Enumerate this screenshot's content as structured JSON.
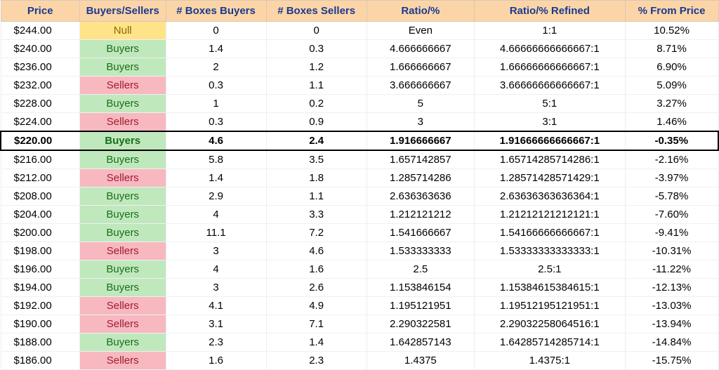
{
  "headers": [
    "Price",
    "Buyers/Sellers",
    "# Boxes Buyers",
    "# Boxes Sellers",
    "Ratio/%",
    "Ratio/% Refined",
    "% From Price"
  ],
  "rows": [
    {
      "price": "$244.00",
      "bs": "Null",
      "bs_class": "bs-null",
      "box_b": "0",
      "box_s": "0",
      "ratio": "Even",
      "refined": "1:1",
      "pct": "10.52%",
      "hl": false
    },
    {
      "price": "$240.00",
      "bs": "Buyers",
      "bs_class": "bs-buyers",
      "box_b": "1.4",
      "box_s": "0.3",
      "ratio": "4.666666667",
      "refined": "4.66666666666667:1",
      "pct": "8.71%",
      "hl": false
    },
    {
      "price": "$236.00",
      "bs": "Buyers",
      "bs_class": "bs-buyers",
      "box_b": "2",
      "box_s": "1.2",
      "ratio": "1.666666667",
      "refined": "1.66666666666667:1",
      "pct": "6.90%",
      "hl": false
    },
    {
      "price": "$232.00",
      "bs": "Sellers",
      "bs_class": "bs-sellers",
      "box_b": "0.3",
      "box_s": "1.1",
      "ratio": "3.666666667",
      "refined": "3.66666666666667:1",
      "pct": "5.09%",
      "hl": false
    },
    {
      "price": "$228.00",
      "bs": "Buyers",
      "bs_class": "bs-buyers",
      "box_b": "1",
      "box_s": "0.2",
      "ratio": "5",
      "refined": "5:1",
      "pct": "3.27%",
      "hl": false
    },
    {
      "price": "$224.00",
      "bs": "Sellers",
      "bs_class": "bs-sellers",
      "box_b": "0.3",
      "box_s": "0.9",
      "ratio": "3",
      "refined": "3:1",
      "pct": "1.46%",
      "hl": false
    },
    {
      "price": "$220.00",
      "bs": "Buyers",
      "bs_class": "bs-buyers",
      "box_b": "4.6",
      "box_s": "2.4",
      "ratio": "1.916666667",
      "refined": "1.91666666666667:1",
      "pct": "-0.35%",
      "hl": true
    },
    {
      "price": "$216.00",
      "bs": "Buyers",
      "bs_class": "bs-buyers",
      "box_b": "5.8",
      "box_s": "3.5",
      "ratio": "1.657142857",
      "refined": "1.65714285714286:1",
      "pct": "-2.16%",
      "hl": false
    },
    {
      "price": "$212.00",
      "bs": "Sellers",
      "bs_class": "bs-sellers",
      "box_b": "1.4",
      "box_s": "1.8",
      "ratio": "1.285714286",
      "refined": "1.28571428571429:1",
      "pct": "-3.97%",
      "hl": false
    },
    {
      "price": "$208.00",
      "bs": "Buyers",
      "bs_class": "bs-buyers",
      "box_b": "2.9",
      "box_s": "1.1",
      "ratio": "2.636363636",
      "refined": "2.63636363636364:1",
      "pct": "-5.78%",
      "hl": false
    },
    {
      "price": "$204.00",
      "bs": "Buyers",
      "bs_class": "bs-buyers",
      "box_b": "4",
      "box_s": "3.3",
      "ratio": "1.212121212",
      "refined": "1.21212121212121:1",
      "pct": "-7.60%",
      "hl": false
    },
    {
      "price": "$200.00",
      "bs": "Buyers",
      "bs_class": "bs-buyers",
      "box_b": "11.1",
      "box_s": "7.2",
      "ratio": "1.541666667",
      "refined": "1.54166666666667:1",
      "pct": "-9.41%",
      "hl": false
    },
    {
      "price": "$198.00",
      "bs": "Sellers",
      "bs_class": "bs-sellers",
      "box_b": "3",
      "box_s": "4.6",
      "ratio": "1.533333333",
      "refined": "1.53333333333333:1",
      "pct": "-10.31%",
      "hl": false
    },
    {
      "price": "$196.00",
      "bs": "Buyers",
      "bs_class": "bs-buyers",
      "box_b": "4",
      "box_s": "1.6",
      "ratio": "2.5",
      "refined": "2.5:1",
      "pct": "-11.22%",
      "hl": false
    },
    {
      "price": "$194.00",
      "bs": "Buyers",
      "bs_class": "bs-buyers",
      "box_b": "3",
      "box_s": "2.6",
      "ratio": "1.153846154",
      "refined": "1.15384615384615:1",
      "pct": "-12.13%",
      "hl": false
    },
    {
      "price": "$192.00",
      "bs": "Sellers",
      "bs_class": "bs-sellers",
      "box_b": "4.1",
      "box_s": "4.9",
      "ratio": "1.195121951",
      "refined": "1.19512195121951:1",
      "pct": "-13.03%",
      "hl": false
    },
    {
      "price": "$190.00",
      "bs": "Sellers",
      "bs_class": "bs-sellers",
      "box_b": "3.1",
      "box_s": "7.1",
      "ratio": "2.290322581",
      "refined": "2.29032258064516:1",
      "pct": "-13.94%",
      "hl": false
    },
    {
      "price": "$188.00",
      "bs": "Buyers",
      "bs_class": "bs-buyers",
      "box_b": "2.3",
      "box_s": "1.4",
      "ratio": "1.642857143",
      "refined": "1.64285714285714:1",
      "pct": "-14.84%",
      "hl": false
    },
    {
      "price": "$186.00",
      "bs": "Sellers",
      "bs_class": "bs-sellers",
      "box_b": "1.6",
      "box_s": "2.3",
      "ratio": "1.4375",
      "refined": "1.4375:1",
      "pct": "-15.75%",
      "hl": false
    }
  ]
}
